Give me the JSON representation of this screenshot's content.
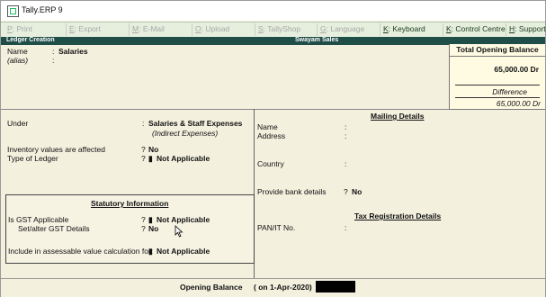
{
  "window": {
    "title": "Tally.ERP 9"
  },
  "buttons": [
    {
      "key": "P",
      "label": ": Print",
      "enabled": false
    },
    {
      "key": "E",
      "label": ": Export",
      "enabled": false
    },
    {
      "key": "M",
      "label": ": E-Mail",
      "enabled": false
    },
    {
      "key": "O",
      "label": ": Upload",
      "enabled": false
    },
    {
      "key": "S",
      "label": ": TallyShop",
      "enabled": false
    },
    {
      "key": "G",
      "label": ": Language",
      "enabled": false
    },
    {
      "key": "K",
      "label": ": Keyboard",
      "enabled": true
    },
    {
      "key": "K",
      "label": ": Control Centre",
      "enabled": true
    },
    {
      "key": "H",
      "label": ": Support",
      "enabled": true
    }
  ],
  "header": {
    "left": "Ledger Creation",
    "company": "Swayam Sales"
  },
  "ledger": {
    "name_label": "Name",
    "name_colon": ":",
    "name_value": "Salaries",
    "alias_label": "(alias)",
    "alias_colon": ":"
  },
  "opening_panel": {
    "title": "Total Opening Balance",
    "amount": "65,000.00 Dr",
    "difference_label": "Difference",
    "difference_value": "65,000.00 Dr"
  },
  "left": {
    "under_label": "Under",
    "under_colon": ":",
    "under_value": "Salaries & Staff Expenses",
    "under_sub": "(Indirect Expenses)",
    "inventory_label": "Inventory values are affected",
    "inventory_q": "?",
    "inventory_value": "No",
    "type_label": "Type of Ledger",
    "type_q": "?",
    "type_mark": "▮",
    "type_value": "Not Applicable"
  },
  "statutory": {
    "title": "Statutory Information",
    "gst_label": "Is GST Applicable",
    "gst_q": "?",
    "gst_mark": "▮",
    "gst_value": "Not Applicable",
    "setalter_label": "Set/alter GST Details",
    "setalter_q": "?",
    "setalter_value": "No",
    "assess_label": "Include in assessable value calculation for:",
    "assess_mark": "▮",
    "assess_value": "Not Applicable"
  },
  "mailing": {
    "title": "Mailing Details",
    "name_label": "Name",
    "name_colon": ":",
    "address_label": "Address",
    "address_colon": ":",
    "country_label": "Country",
    "country_colon": ":",
    "bank_label": "Provide bank details",
    "bank_q": "?",
    "bank_value": "No"
  },
  "tax": {
    "title": "Tax Registration Details",
    "pan_label": "PAN/IT No.",
    "pan_colon": ":"
  },
  "footer": {
    "label": "Opening Balance",
    "date": "( on 1-Apr-2020)",
    "colon": ":"
  }
}
